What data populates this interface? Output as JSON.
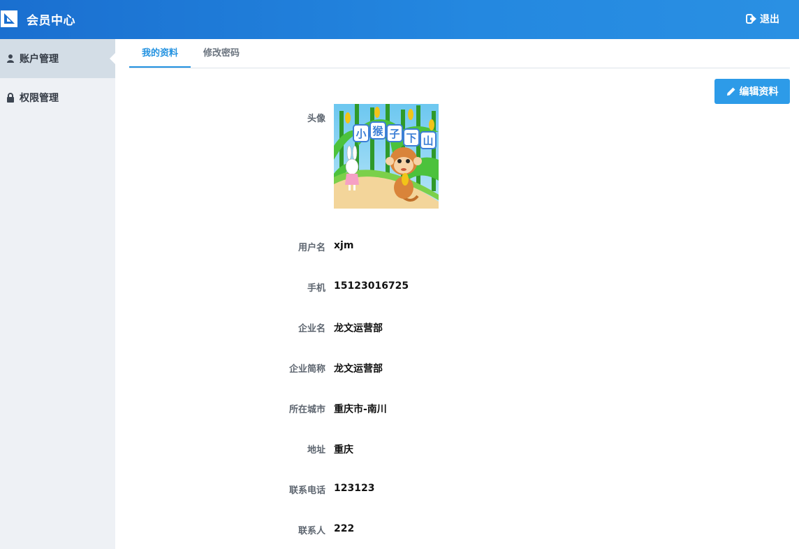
{
  "header": {
    "title": "会员中心",
    "logout_label": "退出",
    "logo_icon": "app-logo-icon",
    "logout_icon": "sign-out-icon"
  },
  "sidebar": {
    "items": [
      {
        "label": "账户管理",
        "icon": "user-icon",
        "active": true
      },
      {
        "label": "权限管理",
        "icon": "lock-icon",
        "active": false
      }
    ]
  },
  "tabs": [
    {
      "label": "我的资料",
      "active": true
    },
    {
      "label": "修改密码",
      "active": false
    }
  ],
  "toolbar": {
    "edit_label": "编辑资料",
    "edit_icon": "pencil-icon"
  },
  "profile": {
    "avatar_label": "头像",
    "avatar_text": "小猴子下山",
    "fields": [
      {
        "label": "用户名",
        "value": "xjm"
      },
      {
        "label": "手机",
        "value": "15123016725"
      },
      {
        "label": "企业名",
        "value": "龙文运营部"
      },
      {
        "label": "企业简称",
        "value": "龙文运营部"
      },
      {
        "label": "所在城市",
        "value": "重庆市-南川"
      },
      {
        "label": "地址",
        "value": "重庆"
      },
      {
        "label": "联系电话",
        "value": "123123"
      },
      {
        "label": "联系人",
        "value": "222"
      }
    ]
  },
  "colors": {
    "header_start": "#1a6fd0",
    "header_end": "#2a90e3",
    "accent": "#2392e0",
    "button": "#2d9be8",
    "sidebar_bg": "#eef1f5",
    "sidebar_active": "#d3dde6"
  }
}
